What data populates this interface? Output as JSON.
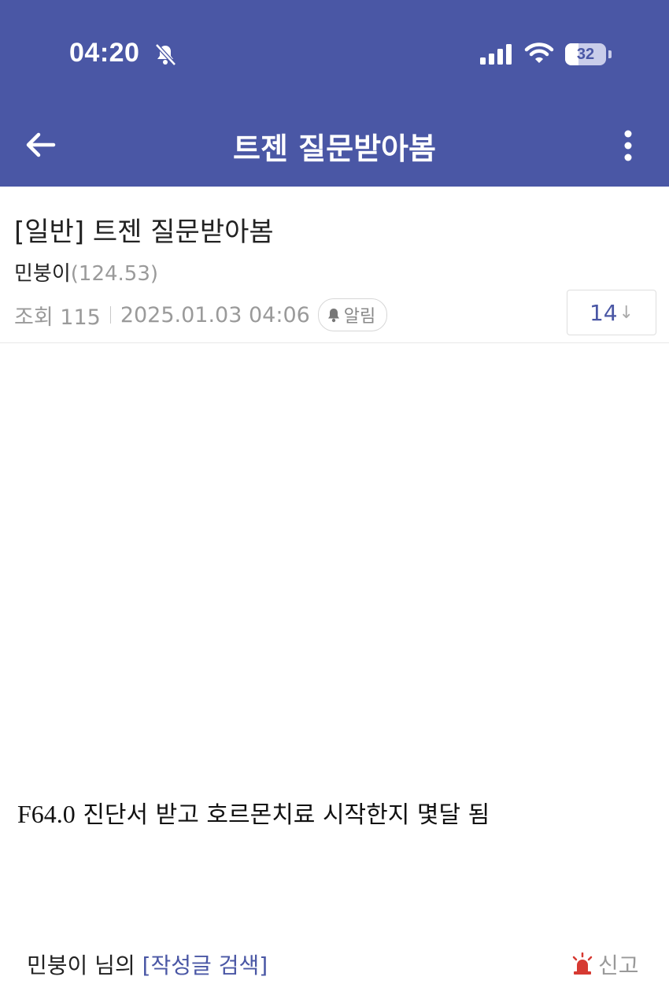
{
  "status_bar": {
    "time": "04:20",
    "battery": "32",
    "battery_level_percent": 32
  },
  "nav": {
    "title": "트젠 질문받아봄"
  },
  "post": {
    "title": "[일반] 트젠 질문받아봄",
    "author": "민붕이",
    "author_ip": "(124.53)",
    "views": "조회 115",
    "date": "2025.01.03 04:06",
    "alarm_label": "알림",
    "comment_count": "14",
    "comment_arrow": "↓",
    "content_code": "F64.0",
    "content_text": " 진단서 받고 호르몬치료 시작한지 몇달 됨"
  },
  "footer": {
    "search_prefix": "민붕이 님의 ",
    "search_link": "[작성글 검색]",
    "report_label": "신고"
  },
  "colors": {
    "brand": "#4a57a5",
    "report_red": "#d63a32"
  },
  "icons": [
    "bell-off-icon",
    "signal-icon",
    "wifi-icon",
    "back-arrow-icon",
    "more-vertical-icon",
    "bell-icon",
    "siren-icon"
  ]
}
